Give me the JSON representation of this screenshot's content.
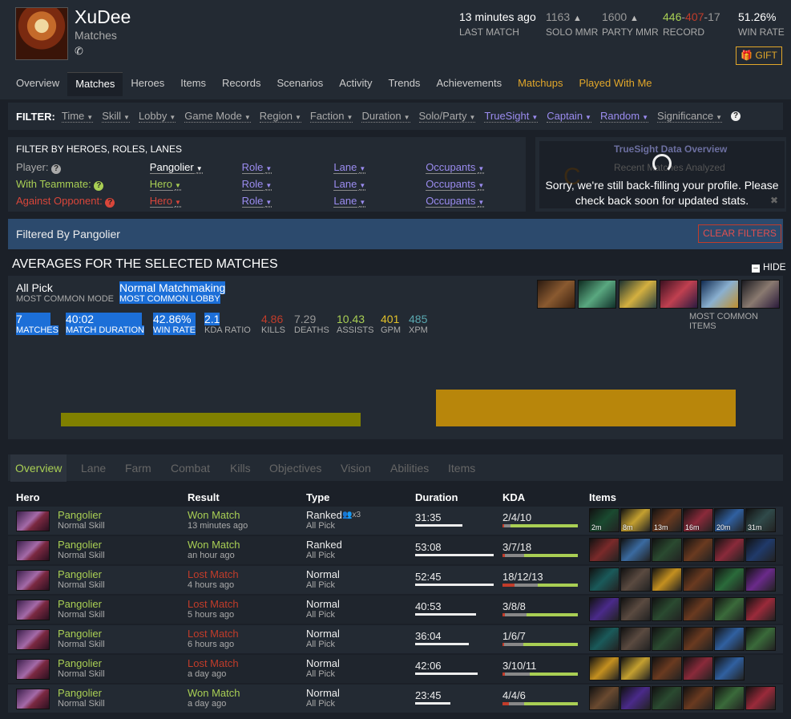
{
  "profile": {
    "name": "XuDee",
    "subtitle": "Matches",
    "phone_icon": "phone-icon"
  },
  "stats": [
    {
      "value": "13 minutes ago",
      "label": "LAST MATCH"
    },
    {
      "value": "1163",
      "label": "SOLO MMR",
      "icon": "warning-icon"
    },
    {
      "value": "1600",
      "label": "PARTY MMR",
      "icon": "warning-icon"
    },
    {
      "wins": "446",
      "sep1": "-",
      "losses": "407",
      "sep2": "-",
      "abandons": "17",
      "label": "RECORD"
    },
    {
      "value": "51.26%",
      "label": "WIN RATE"
    }
  ],
  "gift": "GIFT",
  "nav_tabs": [
    "Overview",
    "Matches",
    "Heroes",
    "Items",
    "Records",
    "Scenarios",
    "Activity",
    "Trends",
    "Achievements",
    "Matchups",
    "Played With Me"
  ],
  "active_tab": "Matches",
  "filter": {
    "label": "FILTER:",
    "items": [
      "Time",
      "Skill",
      "Lobby",
      "Game Mode",
      "Region",
      "Faction",
      "Duration",
      "Solo/Party",
      "TrueSight",
      "Captain",
      "Random",
      "Significance"
    ]
  },
  "hero_filter": {
    "title": "FILTER BY HEROES, ROLES, LANES",
    "rows": [
      {
        "label": "Player:",
        "hero": "Pangolier",
        "role": "Role",
        "lane": "Lane",
        "occupants": "Occupants"
      },
      {
        "label": "With Teammate:",
        "hero": "Hero",
        "role": "Role",
        "lane": "Lane",
        "occupants": "Occupants"
      },
      {
        "label": "Against Opponent:",
        "hero": "Hero",
        "role": "Role",
        "lane": "Lane",
        "occupants": "Occupants"
      }
    ]
  },
  "truesight": {
    "title": "TrueSight Data Overview",
    "row": "Recent Matches Analyzed",
    "message": "Sorry, we're still back-filling your profile. Please check back soon for updated stats."
  },
  "filtered_by": "Filtered By Pangolier",
  "clear_filters": "CLEAR FILTERS",
  "averages": {
    "title": "AVERAGES FOR THE SELECTED MATCHES",
    "hide": "HIDE",
    "mode": {
      "value": "All Pick",
      "label": "MOST COMMON MODE"
    },
    "lobby": {
      "value": "Normal Matchmaking",
      "label": "MOST COMMON LOBBY"
    },
    "metrics": [
      {
        "value": "7",
        "label": "MATCHES"
      },
      {
        "value": "40:02",
        "label": "MATCH DURATION"
      },
      {
        "value": "42.86%",
        "label": "WIN RATE"
      },
      {
        "value": "2.1",
        "label": "KDA RATIO"
      },
      {
        "value": "4.86",
        "label": "KILLS"
      },
      {
        "value": "7.29",
        "label": "DEATHS"
      },
      {
        "value": "10.43",
        "label": "ASSISTS"
      },
      {
        "value": "401",
        "label": "GPM"
      },
      {
        "value": "485",
        "label": "XPM"
      }
    ],
    "common_items_label": "MOST COMMON ITEMS"
  },
  "lower_tabs": [
    "Overview",
    "Lane",
    "Farm",
    "Combat",
    "Kills",
    "Objectives",
    "Vision",
    "Abilities",
    "Items"
  ],
  "table": {
    "headers": [
      "Hero",
      "Result",
      "Type",
      "Duration",
      "KDA",
      "Items"
    ],
    "rows": [
      {
        "hero": "Pangolier",
        "skill": "Normal Skill",
        "result": "Won Match",
        "when": "13 minutes ago",
        "type": "Ranked",
        "mode": "All Pick",
        "party": "x3",
        "duration": "31:35",
        "kda": "2/4/10",
        "item_times": [
          "2m",
          "8m",
          "13m",
          "16m",
          "20m",
          "31m"
        ]
      },
      {
        "hero": "Pangolier",
        "skill": "Normal Skill",
        "result": "Won Match",
        "when": "an hour ago",
        "type": "Ranked",
        "mode": "All Pick",
        "duration": "53:08",
        "kda": "3/7/18"
      },
      {
        "hero": "Pangolier",
        "skill": "Normal Skill",
        "result": "Lost Match",
        "when": "4 hours ago",
        "type": "Normal",
        "mode": "All Pick",
        "duration": "52:45",
        "kda": "18/12/13"
      },
      {
        "hero": "Pangolier",
        "skill": "Normal Skill",
        "result": "Lost Match",
        "when": "5 hours ago",
        "type": "Normal",
        "mode": "All Pick",
        "duration": "40:53",
        "kda": "3/8/8"
      },
      {
        "hero": "Pangolier",
        "skill": "Normal Skill",
        "result": "Lost Match",
        "when": "6 hours ago",
        "type": "Normal",
        "mode": "All Pick",
        "duration": "36:04",
        "kda": "1/6/7"
      },
      {
        "hero": "Pangolier",
        "skill": "Normal Skill",
        "result": "Lost Match",
        "when": "a day ago",
        "type": "Normal",
        "mode": "All Pick",
        "duration": "42:06",
        "kda": "3/10/11"
      },
      {
        "hero": "Pangolier",
        "skill": "Normal Skill",
        "result": "Won Match",
        "when": "a day ago",
        "type": "Normal",
        "mode": "All Pick",
        "duration": "23:45",
        "kda": "4/4/6"
      }
    ]
  },
  "colors": {
    "accent_orange": "#e2a72a",
    "win_green": "#a9cf54",
    "loss_red": "#c23c2a",
    "highlight_blue": "#1c6fd8",
    "truesight_purple": "#9b8cf0"
  }
}
